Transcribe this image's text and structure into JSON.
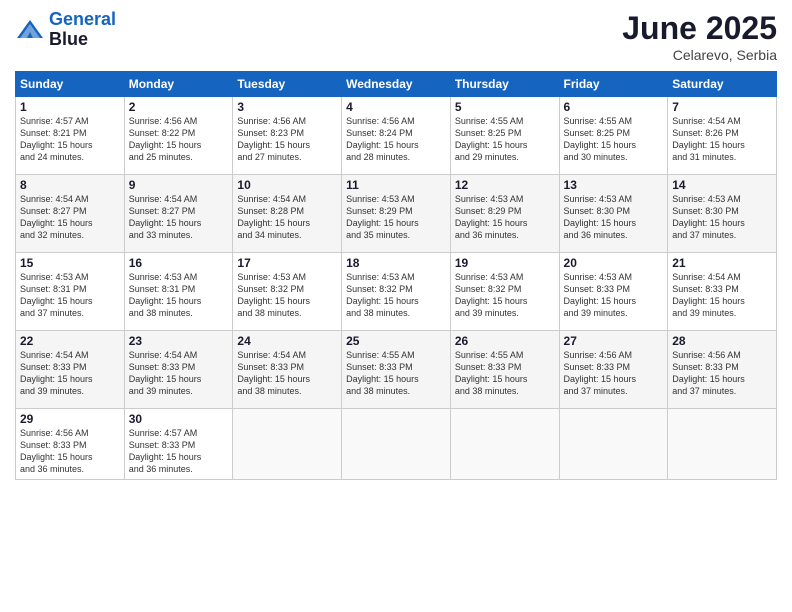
{
  "logo": {
    "line1": "General",
    "line2": "Blue"
  },
  "title": "June 2025",
  "location": "Celarevo, Serbia",
  "weekdays": [
    "Sunday",
    "Monday",
    "Tuesday",
    "Wednesday",
    "Thursday",
    "Friday",
    "Saturday"
  ],
  "weeks": [
    [
      {
        "day": "1",
        "info": "Sunrise: 4:57 AM\nSunset: 8:21 PM\nDaylight: 15 hours\nand 24 minutes."
      },
      {
        "day": "2",
        "info": "Sunrise: 4:56 AM\nSunset: 8:22 PM\nDaylight: 15 hours\nand 25 minutes."
      },
      {
        "day": "3",
        "info": "Sunrise: 4:56 AM\nSunset: 8:23 PM\nDaylight: 15 hours\nand 27 minutes."
      },
      {
        "day": "4",
        "info": "Sunrise: 4:56 AM\nSunset: 8:24 PM\nDaylight: 15 hours\nand 28 minutes."
      },
      {
        "day": "5",
        "info": "Sunrise: 4:55 AM\nSunset: 8:25 PM\nDaylight: 15 hours\nand 29 minutes."
      },
      {
        "day": "6",
        "info": "Sunrise: 4:55 AM\nSunset: 8:25 PM\nDaylight: 15 hours\nand 30 minutes."
      },
      {
        "day": "7",
        "info": "Sunrise: 4:54 AM\nSunset: 8:26 PM\nDaylight: 15 hours\nand 31 minutes."
      }
    ],
    [
      {
        "day": "8",
        "info": "Sunrise: 4:54 AM\nSunset: 8:27 PM\nDaylight: 15 hours\nand 32 minutes."
      },
      {
        "day": "9",
        "info": "Sunrise: 4:54 AM\nSunset: 8:27 PM\nDaylight: 15 hours\nand 33 minutes."
      },
      {
        "day": "10",
        "info": "Sunrise: 4:54 AM\nSunset: 8:28 PM\nDaylight: 15 hours\nand 34 minutes."
      },
      {
        "day": "11",
        "info": "Sunrise: 4:53 AM\nSunset: 8:29 PM\nDaylight: 15 hours\nand 35 minutes."
      },
      {
        "day": "12",
        "info": "Sunrise: 4:53 AM\nSunset: 8:29 PM\nDaylight: 15 hours\nand 36 minutes."
      },
      {
        "day": "13",
        "info": "Sunrise: 4:53 AM\nSunset: 8:30 PM\nDaylight: 15 hours\nand 36 minutes."
      },
      {
        "day": "14",
        "info": "Sunrise: 4:53 AM\nSunset: 8:30 PM\nDaylight: 15 hours\nand 37 minutes."
      }
    ],
    [
      {
        "day": "15",
        "info": "Sunrise: 4:53 AM\nSunset: 8:31 PM\nDaylight: 15 hours\nand 37 minutes."
      },
      {
        "day": "16",
        "info": "Sunrise: 4:53 AM\nSunset: 8:31 PM\nDaylight: 15 hours\nand 38 minutes."
      },
      {
        "day": "17",
        "info": "Sunrise: 4:53 AM\nSunset: 8:32 PM\nDaylight: 15 hours\nand 38 minutes."
      },
      {
        "day": "18",
        "info": "Sunrise: 4:53 AM\nSunset: 8:32 PM\nDaylight: 15 hours\nand 38 minutes."
      },
      {
        "day": "19",
        "info": "Sunrise: 4:53 AM\nSunset: 8:32 PM\nDaylight: 15 hours\nand 39 minutes."
      },
      {
        "day": "20",
        "info": "Sunrise: 4:53 AM\nSunset: 8:33 PM\nDaylight: 15 hours\nand 39 minutes."
      },
      {
        "day": "21",
        "info": "Sunrise: 4:54 AM\nSunset: 8:33 PM\nDaylight: 15 hours\nand 39 minutes."
      }
    ],
    [
      {
        "day": "22",
        "info": "Sunrise: 4:54 AM\nSunset: 8:33 PM\nDaylight: 15 hours\nand 39 minutes."
      },
      {
        "day": "23",
        "info": "Sunrise: 4:54 AM\nSunset: 8:33 PM\nDaylight: 15 hours\nand 39 minutes."
      },
      {
        "day": "24",
        "info": "Sunrise: 4:54 AM\nSunset: 8:33 PM\nDaylight: 15 hours\nand 38 minutes."
      },
      {
        "day": "25",
        "info": "Sunrise: 4:55 AM\nSunset: 8:33 PM\nDaylight: 15 hours\nand 38 minutes."
      },
      {
        "day": "26",
        "info": "Sunrise: 4:55 AM\nSunset: 8:33 PM\nDaylight: 15 hours\nand 38 minutes."
      },
      {
        "day": "27",
        "info": "Sunrise: 4:56 AM\nSunset: 8:33 PM\nDaylight: 15 hours\nand 37 minutes."
      },
      {
        "day": "28",
        "info": "Sunrise: 4:56 AM\nSunset: 8:33 PM\nDaylight: 15 hours\nand 37 minutes."
      }
    ],
    [
      {
        "day": "29",
        "info": "Sunrise: 4:56 AM\nSunset: 8:33 PM\nDaylight: 15 hours\nand 36 minutes."
      },
      {
        "day": "30",
        "info": "Sunrise: 4:57 AM\nSunset: 8:33 PM\nDaylight: 15 hours\nand 36 minutes."
      },
      {
        "day": "",
        "info": ""
      },
      {
        "day": "",
        "info": ""
      },
      {
        "day": "",
        "info": ""
      },
      {
        "day": "",
        "info": ""
      },
      {
        "day": "",
        "info": ""
      }
    ]
  ]
}
